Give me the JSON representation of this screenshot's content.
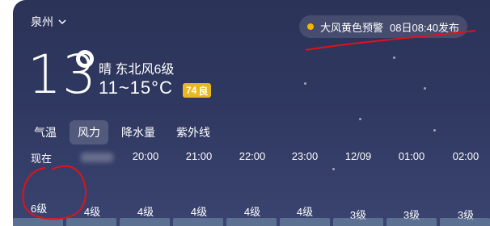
{
  "location": {
    "city": "泉州"
  },
  "alert": {
    "text": "大风黄色预警",
    "time": "08日08:40发布",
    "color": "#f5b400"
  },
  "current": {
    "temperature": "13",
    "condition": "晴 东北风6级",
    "range": "11~15°C",
    "aqi": {
      "value": "74",
      "label": "良",
      "color": "#e9b722"
    }
  },
  "tabs": [
    {
      "label": "气温",
      "active": false
    },
    {
      "label": "风力",
      "active": true
    },
    {
      "label": "降水量",
      "active": false
    },
    {
      "label": "紫外线",
      "active": false
    }
  ],
  "hourly": [
    {
      "time": "现在",
      "level": "6级"
    },
    {
      "time": "",
      "level": "4级"
    },
    {
      "time": "20:00",
      "level": "4级"
    },
    {
      "time": "21:00",
      "level": "4级"
    },
    {
      "time": "22:00",
      "level": "4级"
    },
    {
      "time": "23:00",
      "level": "4级"
    },
    {
      "time": "12/09",
      "level": "3级"
    },
    {
      "time": "01:00",
      "level": "3级"
    },
    {
      "time": "02:00",
      "level": "3级"
    }
  ],
  "colors": {
    "background": "#2f3860",
    "annotation": "#e0121b"
  }
}
